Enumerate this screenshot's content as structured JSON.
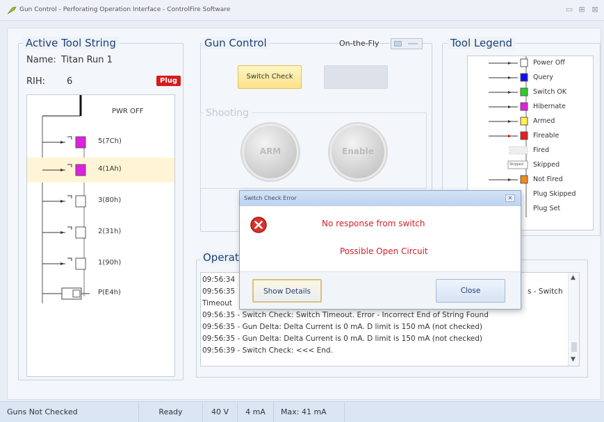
{
  "window": {
    "title": "Gun Control - Perforating Operation Interface - ControlFire Software",
    "minimize": "▭",
    "maximize": "⊞",
    "close": "⊠"
  },
  "tool_string": {
    "title": "Active Tool String",
    "name_label": "Name:",
    "name_value": "Titan Run 1",
    "rih_label": "RIH:",
    "rih_value": "6",
    "plug_badge": "Plug",
    "items": [
      {
        "label": "PWR OFF",
        "color": null
      },
      {
        "label": "5(7Ch)",
        "color": "#e020e0"
      },
      {
        "label": "4(1Ah)",
        "color": "#e020e0",
        "selected": true
      },
      {
        "label": "3(80h)",
        "color": "#ffffff"
      },
      {
        "label": "2(31h)",
        "color": "#ffffff"
      },
      {
        "label": "1(90h)",
        "color": "#ffffff"
      },
      {
        "label": "P(E4h)",
        "color": "#ffffff"
      }
    ]
  },
  "gun_control": {
    "title": "Gun Control",
    "on_the_fly_label": "On-the-Fly",
    "switch_check_label": "Switch Check",
    "disabled_button_label": "",
    "shooting_title": "Shooting",
    "arm_label": "ARM",
    "enable_label": "Enable"
  },
  "legend": {
    "title": "Tool Legend",
    "items": [
      {
        "label": "Power Off",
        "color": "#ffffff"
      },
      {
        "label": "Query",
        "color": "#1010e8"
      },
      {
        "label": "Switch OK",
        "color": "#28d028"
      },
      {
        "label": "Hibernate",
        "color": "#e020e0"
      },
      {
        "label": "Armed",
        "color": "#fff24a"
      },
      {
        "label": "Fireable",
        "color": "#e81c1c"
      },
      {
        "label": "Fired",
        "color": "#e6e6e6"
      },
      {
        "label": "Skipped",
        "color": "#ffffff",
        "tag": "Skipped"
      },
      {
        "label": "Not Fired",
        "color": "#f08a1a"
      },
      {
        "label": "Plug Skipped",
        "color": "#ffffff"
      },
      {
        "label": "Plug Set",
        "color": "#ffffff"
      }
    ]
  },
  "operations": {
    "title": "Operations",
    "lines": [
      "09:56:34",
      "09:56:35",
      "Timeout",
      "09:56:35 - Switch Check: Switch Timeout. Error - Incorrect End of String Found",
      "09:56:35 - Gun Delta: Delta Current is 0 mA. D limit is 150 mA (not checked)",
      "09:56:35 - Gun Delta: Delta Current is 0 mA. D limit is 150 mA (not checked)",
      "09:56:39 - Switch Check: <<< End."
    ],
    "line2_tail": "s - Switch"
  },
  "status_bar": {
    "guns": "Guns Not Checked",
    "state": "Ready",
    "voltage": "40 V",
    "current": "4 mA",
    "max": "Max: 41 mA"
  },
  "dialog": {
    "title": "Switch Check Error",
    "close_glyph": "✕",
    "message1": "No response from switch",
    "message2": "Possible Open Circuit",
    "show_details": "Show Details",
    "close_button": "Close"
  },
  "colors": {
    "accent": "#1d3f73",
    "error_text": "#d0202a",
    "selected_row": "#fff5d6"
  }
}
